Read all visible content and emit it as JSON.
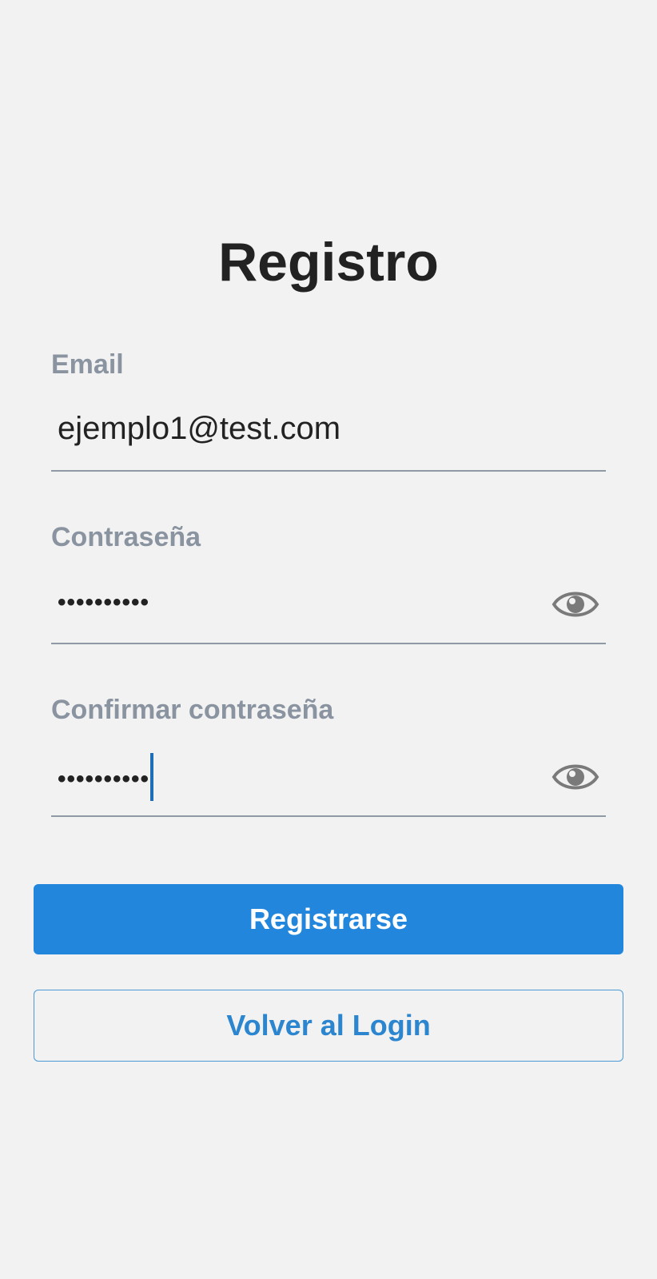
{
  "title": "Registro",
  "fields": {
    "email": {
      "label": "Email",
      "value": "ejemplo1@test.com"
    },
    "password": {
      "label": "Contraseña",
      "value": "••••••••••",
      "icon": "eye-icon"
    },
    "confirm": {
      "label": "Confirmar contraseña",
      "value": "••••••••••",
      "icon": "eye-icon"
    }
  },
  "buttons": {
    "register": "Registrarse",
    "back_to_login": "Volver al Login"
  },
  "colors": {
    "background": "#f2f2f2",
    "primary": "#2287dc",
    "label": "#8a94a0",
    "caret": "#1e6fb8"
  }
}
